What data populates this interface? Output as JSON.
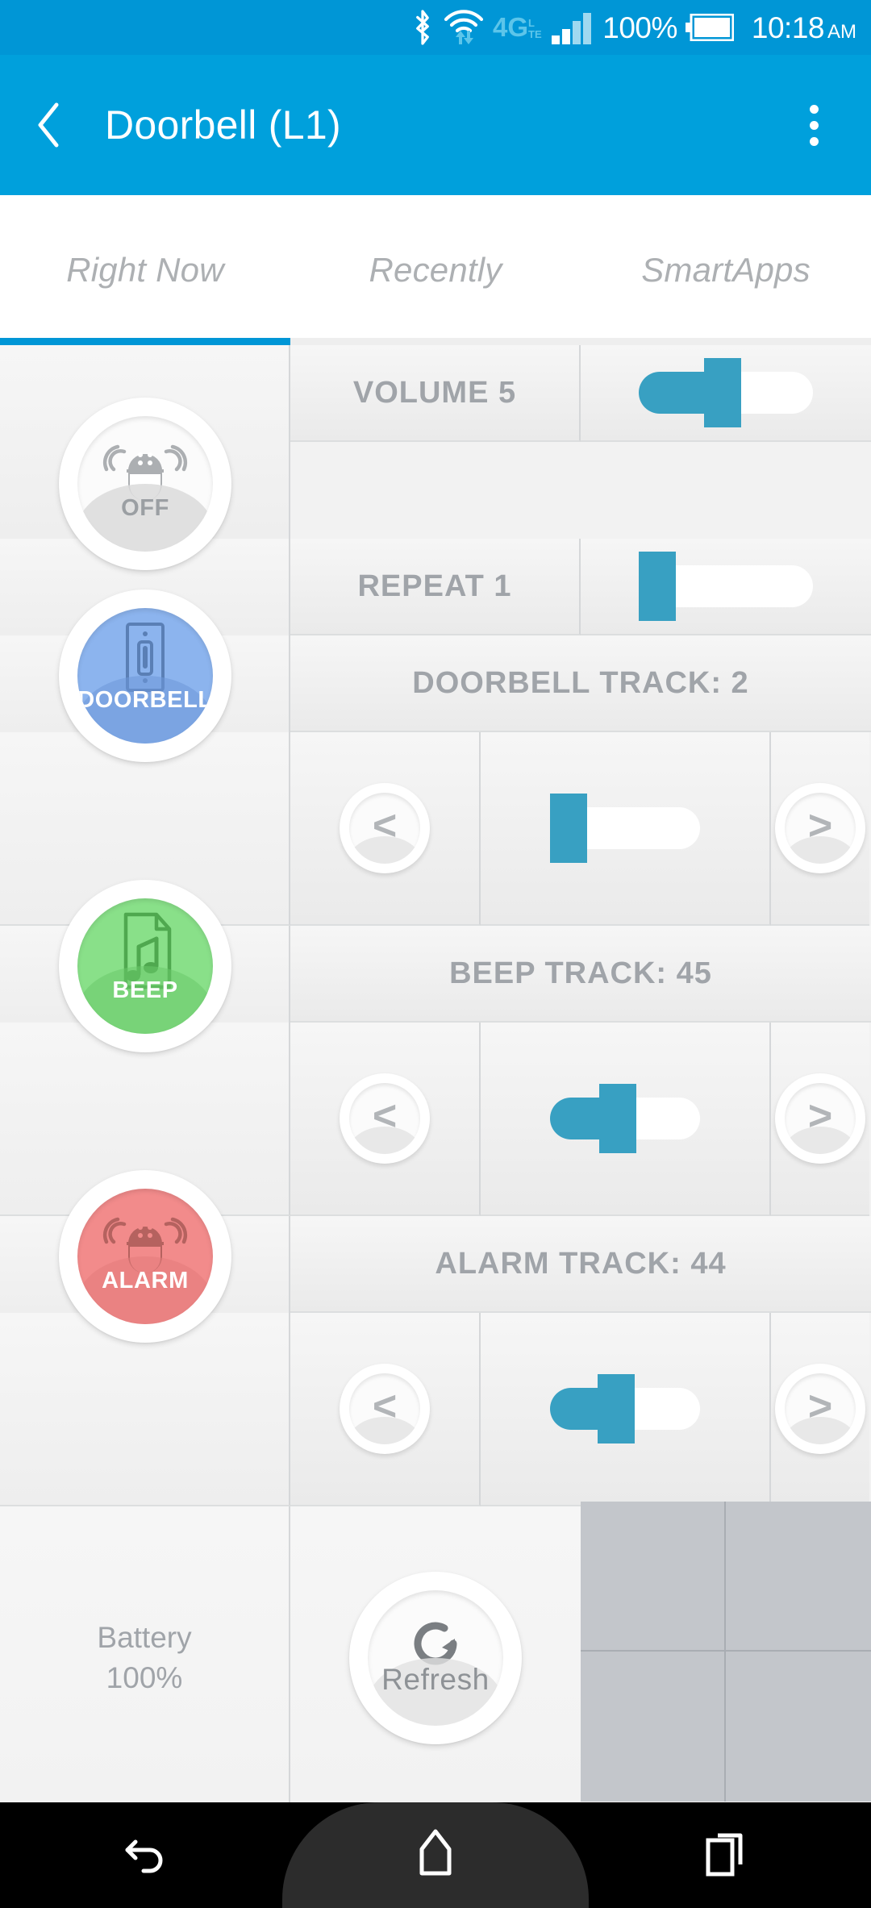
{
  "status_bar": {
    "icons": [
      "bluetooth-icon",
      "wifi-icon",
      "4g-lte-icon",
      "signal-bars-icon"
    ],
    "battery_percent": "100%",
    "time": "10:18",
    "am_pm": "AM",
    "background_color": "#0096d6"
  },
  "app_bar": {
    "title": "Doorbell (L1)",
    "back_label": "‹",
    "background_color": "#00a0dc"
  },
  "tabs": {
    "items": [
      {
        "label": "Right Now",
        "active": true
      },
      {
        "label": "Recently",
        "active": false
      },
      {
        "label": "SmartApps",
        "active": false
      }
    ],
    "active_indicator_color": "#0096d6"
  },
  "accent_color": "#38a0c2",
  "controls": {
    "power": {
      "caption": "OFF",
      "icon": "siren-icon",
      "state_color": "#fbfbfb"
    },
    "volume": {
      "label": "VOLUME 5",
      "value": 5,
      "max": 10,
      "fill_percent": 48
    },
    "repeat": {
      "label": "REPEAT 1",
      "value": 1,
      "max": 10,
      "fill_percent": 10
    },
    "doorbell": {
      "caption": "DOORBELL",
      "icon": "light-switch-icon",
      "state_color": "#8cb4ee",
      "track_label": "DOORBELL TRACK: 2",
      "track_value": 2,
      "fill_percent": 9,
      "prev_label": "<",
      "next_label": ">"
    },
    "beep": {
      "caption": "BEEP",
      "icon": "music-file-icon",
      "state_color": "#89e089",
      "track_label": "BEEP TRACK: 45",
      "track_value": 45,
      "fill_percent": 45,
      "prev_label": "<",
      "next_label": ">"
    },
    "alarm": {
      "caption": "ALARM",
      "icon": "siren-icon",
      "state_color": "#f28b8b",
      "track_label": "ALARM TRACK: 44",
      "track_value": 44,
      "fill_percent": 44,
      "prev_label": "<",
      "next_label": ">"
    },
    "battery": {
      "label": "Battery",
      "value": "100%"
    },
    "refresh": {
      "caption": "Refresh",
      "icon": "refresh-icon"
    }
  },
  "system_nav": {
    "back": "back-icon",
    "home": "home-icon",
    "recents": "recents-icon"
  }
}
